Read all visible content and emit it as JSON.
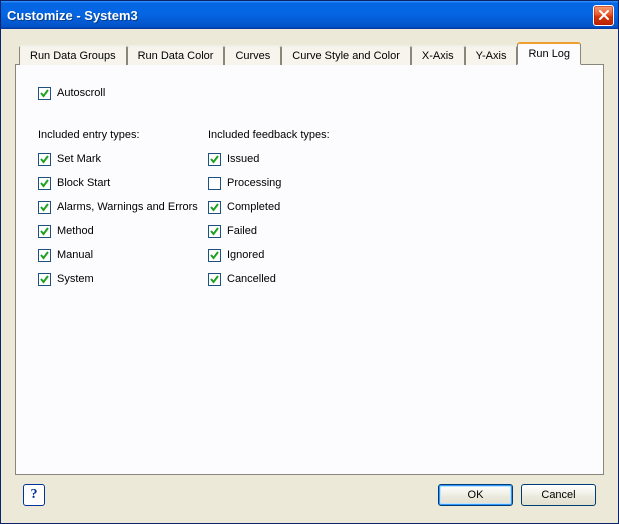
{
  "window": {
    "title": "Customize  -  System3"
  },
  "tabs": [
    {
      "label": "Run Data Groups"
    },
    {
      "label": "Run Data Color"
    },
    {
      "label": "Curves"
    },
    {
      "label": "Curve Style and Color"
    },
    {
      "label": "X-Axis"
    },
    {
      "label": "Y-Axis"
    },
    {
      "label": "Run Log"
    }
  ],
  "runlog": {
    "autoscroll": {
      "label": "Autoscroll",
      "checked": true
    },
    "entry_header": "Included entry types:",
    "feedback_header": "Included feedback types:",
    "entry": [
      {
        "label": "Set Mark",
        "checked": true
      },
      {
        "label": "Block Start",
        "checked": true
      },
      {
        "label": "Alarms, Warnings and Errors",
        "checked": true
      },
      {
        "label": "Method",
        "checked": true
      },
      {
        "label": "Manual",
        "checked": true
      },
      {
        "label": "System",
        "checked": true
      }
    ],
    "feedback": [
      {
        "label": "Issued",
        "checked": true
      },
      {
        "label": "Processing",
        "checked": false
      },
      {
        "label": "Completed",
        "checked": true
      },
      {
        "label": "Failed",
        "checked": true
      },
      {
        "label": "Ignored",
        "checked": true
      },
      {
        "label": "Cancelled",
        "checked": true
      }
    ]
  },
  "buttons": {
    "ok": "OK",
    "cancel": "Cancel"
  }
}
